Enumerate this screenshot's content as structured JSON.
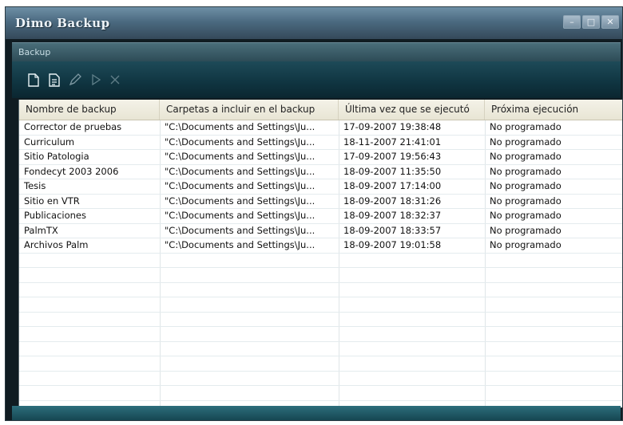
{
  "window": {
    "title": "Dimo Backup",
    "minimize_label": "–",
    "maximize_label": "□",
    "close_label": "✕"
  },
  "panel": {
    "title": "Backup"
  },
  "toolbar": {
    "icons": [
      "new-document-icon",
      "properties-document-icon",
      "edit-icon",
      "run-icon",
      "delete-icon"
    ]
  },
  "table": {
    "columns": [
      "Nombre de backup",
      "Carpetas a incluir en el backup",
      "Última vez que se ejecutó",
      "Próxima ejecución"
    ],
    "rows": [
      [
        "Corrector de pruebas",
        "\"C:\\Documents and Settings\\Ju...",
        "17-09-2007 19:38:48",
        "No programado"
      ],
      [
        "Curriculum",
        "\"C:\\Documents and Settings\\Ju...",
        "18-11-2007 21:41:01",
        "No programado"
      ],
      [
        "Sitio Patologia",
        "\"C:\\Documents and Settings\\Ju...",
        "17-09-2007 19:56:43",
        "No programado"
      ],
      [
        "Fondecyt 2003 2006",
        "\"C:\\Documents and Settings\\Ju...",
        "18-09-2007 11:35:50",
        "No programado"
      ],
      [
        "Tesis",
        "\"C:\\Documents and Settings\\Ju...",
        "18-09-2007 17:14:00",
        "No programado"
      ],
      [
        "Sitio en VTR",
        "\"C:\\Documents and Settings\\Ju...",
        "18-09-2007 18:31:26",
        "No programado"
      ],
      [
        "Publicaciones",
        "\"C:\\Documents and Settings\\Ju...",
        "18-09-2007 18:32:37",
        "No programado"
      ],
      [
        "PalmTX",
        "\"C:\\Documents and Settings\\Ju...",
        "18-09-2007 18:33:57",
        "No programado"
      ],
      [
        "Archivos Palm",
        "\"C:\\Documents and Settings\\Ju...",
        "18-09-2007 19:01:58",
        "No programado"
      ],
      [
        "",
        "",
        "",
        ""
      ],
      [
        "",
        "",
        "",
        ""
      ],
      [
        "",
        "",
        "",
        ""
      ],
      [
        "",
        "",
        "",
        ""
      ],
      [
        "",
        "",
        "",
        ""
      ],
      [
        "",
        "",
        "",
        ""
      ],
      [
        "",
        "",
        "",
        ""
      ],
      [
        "",
        "",
        "",
        ""
      ],
      [
        "",
        "",
        "",
        ""
      ],
      [
        "",
        "",
        "",
        ""
      ],
      [
        "",
        "",
        "",
        ""
      ]
    ]
  }
}
